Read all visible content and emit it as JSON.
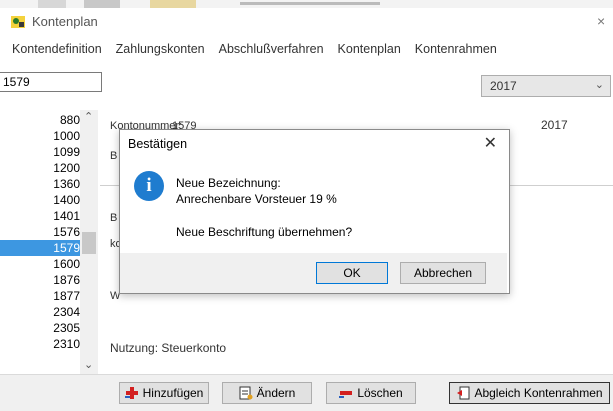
{
  "window": {
    "title": "Kontenplan",
    "close_glyph": "×"
  },
  "menu": [
    "Kontendefinition",
    "Zahlungskonten",
    "Abschlußverfahren",
    "Kontenplan",
    "Kontenrahmen"
  ],
  "search": {
    "value": "1579"
  },
  "year_select": {
    "value": "2017"
  },
  "account_list": [
    "880",
    "1000",
    "1099",
    "1200",
    "1360",
    "1400",
    "1401",
    "1576",
    "1579",
    "1600",
    "1876",
    "1877",
    "2304",
    "2305",
    "2310"
  ],
  "selected_account": "1579",
  "detail": {
    "kontonummer_label": "Kontonummer:",
    "kontonummer_value": "1579",
    "year": "2017",
    "b1": "B",
    "b2": "B",
    "k": "ko",
    "w": "W",
    "nutzung": "Nutzung: Steuerkonto"
  },
  "buttons": {
    "add": "Hinzufügen",
    "edit": "Ändern",
    "delete": "Löschen",
    "sync": "Abgleich Kontenrahmen"
  },
  "dialog": {
    "title": "Bestätigen",
    "line1": "Neue Bezeichnung:",
    "line2": "Anrechenbare Vorsteuer 19 %",
    "question": "Neue Beschriftung übernehmen?",
    "ok": "OK",
    "cancel": "Abbrechen",
    "close_glyph": "✕",
    "info_glyph": "i"
  },
  "colors": {
    "selection": "#3d97e1",
    "info_icon": "#1f7ccf",
    "ok_border": "#0078d7"
  }
}
